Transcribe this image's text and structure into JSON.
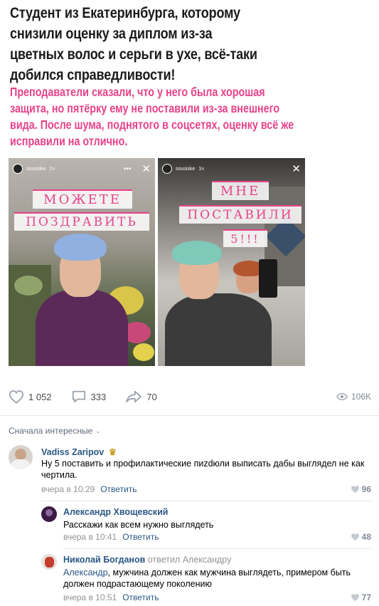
{
  "post": {
    "headline": "Студент из Екатеринбурга, которому снизили оценку за диплом из-за цветных волос и серьги в ухе, всё-таки добился справедливости!",
    "subhead": "Преподаватели сказали, что у него была хорошая защита, но пятёрку ему не поставили из-за внешнего вида. После шума, поднятого в соцсетях, оценку всё же исправили на отлично.",
    "photos": {
      "left": {
        "username": "sousiske",
        "time": "1ч",
        "sticker_line1": "МОЖЕТЕ",
        "sticker_line2": "ПОЗДРАВИТЬ"
      },
      "right": {
        "username": "sousiske",
        "time": "1ч",
        "sticker_line1": "МНЕ",
        "sticker_line2": "ПОСТАВИЛИ",
        "sticker_line3": "5!!!"
      }
    }
  },
  "actions": {
    "likes": "1 052",
    "comments": "333",
    "shares": "70",
    "views": "106K"
  },
  "comments_header": {
    "sort_label": "Сначала интересные"
  },
  "comments": [
    {
      "author": "Vadiss Zaripov",
      "text": "Ну 5 поставить и профилактические пиzdюли выписать дабы выглядел не как чертила.",
      "time": "вчера в 10:29",
      "reply_label": "Ответить",
      "likes": "96"
    },
    {
      "author": "Александр Хвощевский",
      "text": "Расскажи как всем нужно выглядеть",
      "time": "вчера в 10:41",
      "reply_label": "Ответить",
      "likes": "48"
    },
    {
      "author": "Николай Богданов",
      "reply_to": "ответил Александру",
      "addressee": "Александр",
      "text": ", мужчина должен как мужчина выглядеть, примером быть должен подрастающему поколению",
      "time": "вчера в 10:51",
      "reply_label": "Ответить",
      "likes": "77"
    }
  ],
  "colors": {
    "link": "#2a5885",
    "accent_pink": "#e8428a",
    "muted": "#939393"
  }
}
